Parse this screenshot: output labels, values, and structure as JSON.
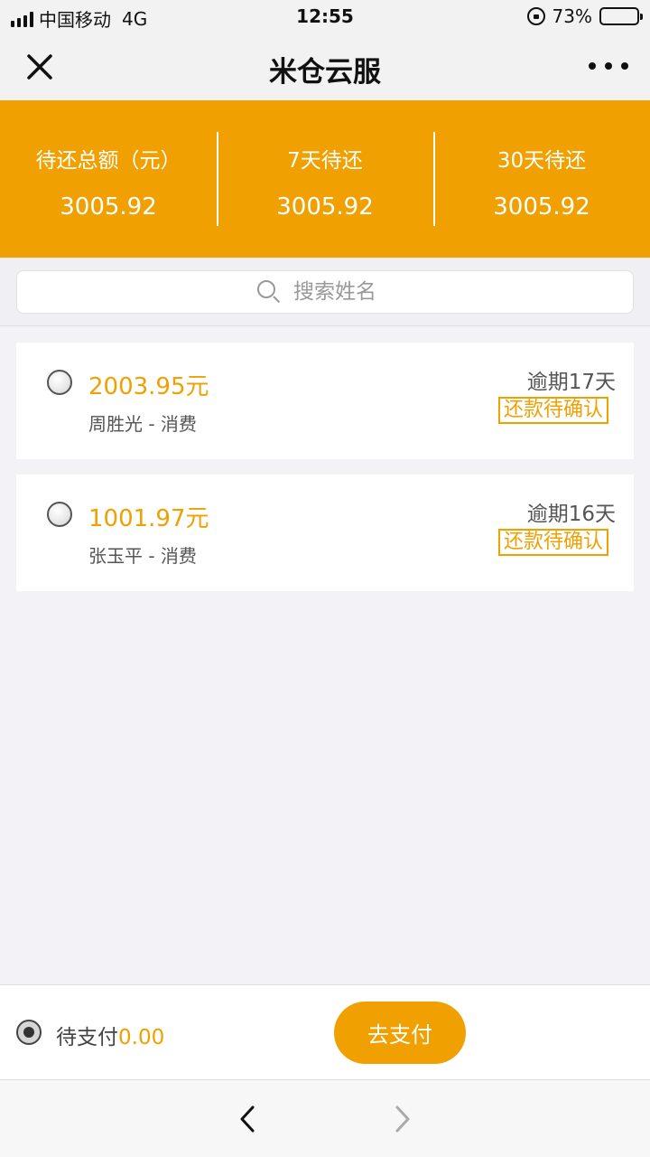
{
  "status_bar": {
    "carrier": "中国移动",
    "network": "4G",
    "time": "12:55",
    "battery_percent": "73%",
    "battery_level": 0.73
  },
  "nav": {
    "title": "米仓云服",
    "close_icon": "close-icon",
    "more_icon": "more-dots-icon"
  },
  "summary": [
    {
      "label": "待还总额（元）",
      "value": "3005.92"
    },
    {
      "label": "7天待还",
      "value": "3005.92"
    },
    {
      "label": "30天待还",
      "value": "3005.92"
    }
  ],
  "search": {
    "placeholder": "搜索姓名",
    "icon": "search-icon"
  },
  "bills": [
    {
      "amount": "2003.95元",
      "description": "周胜光 - 消费",
      "overdue": "逾期17天",
      "status": "还款待确认",
      "selected": false
    },
    {
      "amount": "1001.97元",
      "description": "张玉平 - 消费",
      "overdue": "逾期16天",
      "status": "还款待确认",
      "selected": false
    }
  ],
  "pay_bar": {
    "label": "待支付",
    "amount": "0.00",
    "button_label": "去支付"
  },
  "colors": {
    "accent": "#f0a000",
    "background": "#f3f3f7"
  }
}
